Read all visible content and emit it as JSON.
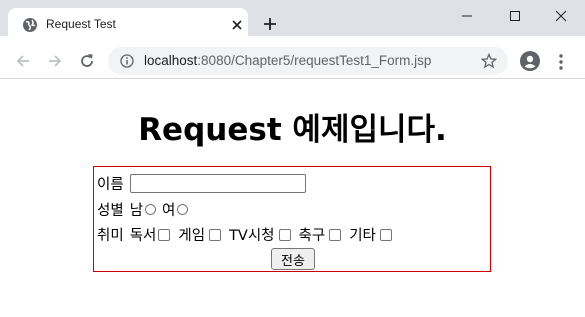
{
  "browser": {
    "tab_title": "Request Test",
    "url_host": "localhost",
    "url_path": ":8080/Chapter5/requestTest1_Form.jsp",
    "icons": [
      "globe-icon",
      "close-icon",
      "plus-icon",
      "minimize-icon",
      "maximize-icon",
      "window-close-icon",
      "back-icon",
      "forward-icon",
      "reload-icon",
      "info-icon",
      "star-icon",
      "account-icon",
      "menu-icon"
    ]
  },
  "page": {
    "heading": "Request 예제입니다.",
    "form": {
      "name_label": "이름",
      "name_value": "",
      "gender_label": "성별",
      "gender_options": [
        "남",
        "여"
      ],
      "hobby_label": "취미",
      "hobby_options": [
        "독서",
        "게임",
        "TV시청",
        "축구",
        "기타"
      ],
      "submit_label": "전송"
    },
    "colors": {
      "form_border": "#cc0000"
    }
  }
}
